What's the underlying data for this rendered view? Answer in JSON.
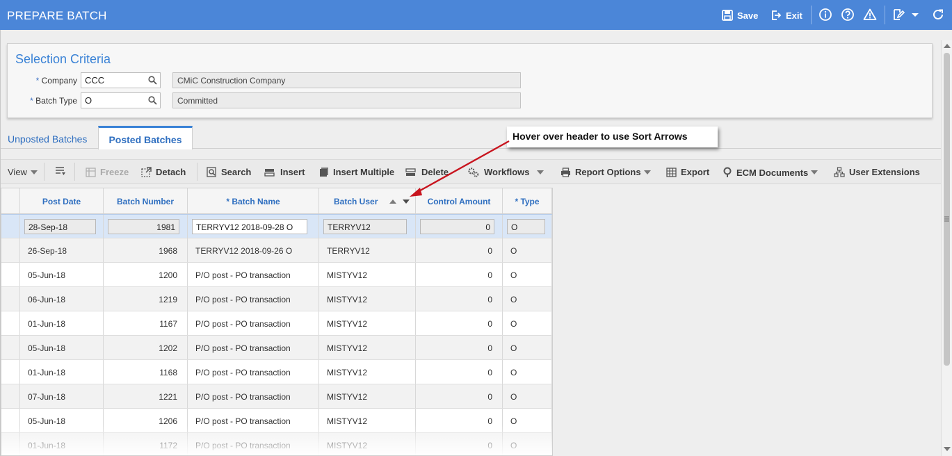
{
  "header": {
    "title": "PREPARE BATCH",
    "save_label": "Save",
    "exit_label": "Exit"
  },
  "criteria": {
    "title": "Selection Criteria",
    "company_label": "Company",
    "company_value": "CCC",
    "company_desc": "CMiC Construction Company",
    "batch_type_label": "Batch Type",
    "batch_type_value": "O",
    "batch_type_desc": "Committed",
    "required_marker": "*"
  },
  "tabs": [
    {
      "label": "Unposted Batches",
      "active": false
    },
    {
      "label": "Posted Batches",
      "active": true
    }
  ],
  "toolbar": {
    "view": "View",
    "freeze": "Freeze",
    "detach": "Detach",
    "search": "Search",
    "insert": "Insert",
    "insert_multiple": "Insert Multiple",
    "delete": "Delete",
    "workflows": "Workflows",
    "report_options": "Report Options",
    "export": "Export",
    "ecm_documents": "ECM Documents",
    "user_extensions": "User Extensions"
  },
  "grid": {
    "columns": [
      "Post Date",
      "Batch Number",
      "* Batch Name",
      "Batch User",
      "Control Amount",
      "* Type"
    ],
    "rows": [
      [
        "28-Sep-18",
        "1981",
        "TERRYV12 2018-09-28 O",
        "TERRYV12",
        "0",
        "O"
      ],
      [
        "26-Sep-18",
        "1968",
        "TERRYV12 2018-09-26 O",
        "TERRYV12",
        "0",
        "O"
      ],
      [
        "05-Jun-18",
        "1200",
        "P/O post - PO transaction",
        "MISTYV12",
        "0",
        "O"
      ],
      [
        "06-Jun-18",
        "1219",
        "P/O post - PO transaction",
        "MISTYV12",
        "0",
        "O"
      ],
      [
        "01-Jun-18",
        "1167",
        "P/O post - PO transaction",
        "MISTYV12",
        "0",
        "O"
      ],
      [
        "05-Jun-18",
        "1202",
        "P/O post - PO transaction",
        "MISTYV12",
        "0",
        "O"
      ],
      [
        "01-Jun-18",
        "1168",
        "P/O post - PO transaction",
        "MISTYV12",
        "0",
        "O"
      ],
      [
        "07-Jun-18",
        "1221",
        "P/O post - PO transaction",
        "MISTYV12",
        "0",
        "O"
      ],
      [
        "05-Jun-18",
        "1206",
        "P/O post - PO transaction",
        "MISTYV12",
        "0",
        "O"
      ],
      [
        "01-Jun-18",
        "1172",
        "P/O post - PO transaction",
        "MISTYV12",
        "0",
        "O"
      ]
    ]
  },
  "callout": {
    "text": "Hover over header to use Sort Arrows"
  },
  "colors": {
    "header_bg": "#4b86d8",
    "accent_blue": "#3a82d6",
    "arrow_red": "#c8141e",
    "selected_row": "#d9e6f7"
  }
}
